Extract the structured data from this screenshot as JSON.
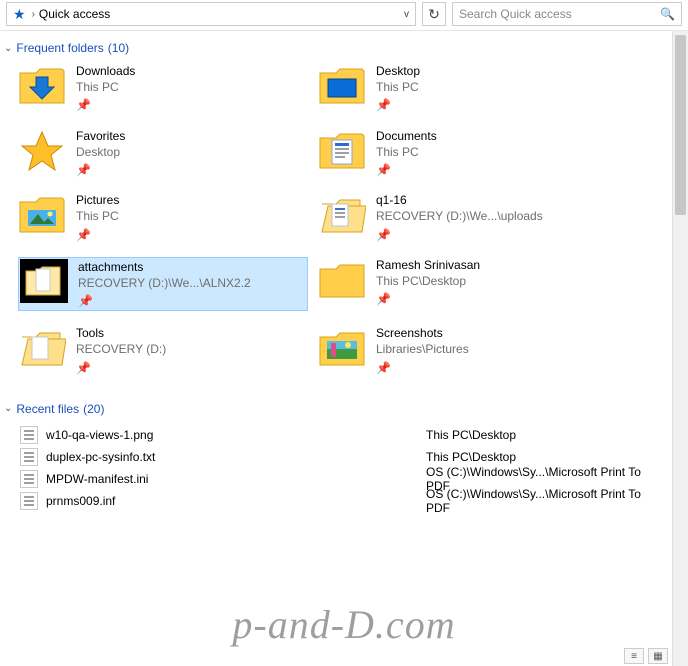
{
  "addressbar": {
    "location": "Quick access"
  },
  "search": {
    "placeholder": "Search Quick access"
  },
  "groups": {
    "frequent": {
      "label": "Frequent folders",
      "count": "(10)"
    },
    "recent": {
      "label": "Recent files",
      "count": "(20)"
    }
  },
  "folders": {
    "col1": [
      {
        "name": "Downloads",
        "path": "This PC",
        "icon": "downloads"
      },
      {
        "name": "Favorites",
        "path": "Desktop",
        "icon": "favorites"
      },
      {
        "name": "Pictures",
        "path": "This PC",
        "icon": "pictures"
      },
      {
        "name": "attachments",
        "path": "RECOVERY (D:)\\We...\\ALNX2.2",
        "icon": "folder",
        "selected": true
      },
      {
        "name": "Tools",
        "path": "RECOVERY (D:)",
        "icon": "folder"
      }
    ],
    "col2": [
      {
        "name": "Desktop",
        "path": "This PC",
        "icon": "desktop"
      },
      {
        "name": "Documents",
        "path": "This PC",
        "icon": "documents"
      },
      {
        "name": "q1-16",
        "path": "RECOVERY (D:)\\We...\\uploads",
        "icon": "folder-open"
      },
      {
        "name": "Ramesh Srinivasan",
        "path": "This PC\\Desktop",
        "icon": "folder"
      },
      {
        "name": "Screenshots",
        "path": "Libraries\\Pictures",
        "icon": "screenshots"
      }
    ]
  },
  "recent_files": [
    {
      "name": "w10-qa-views-1.png",
      "path": "This PC\\Desktop"
    },
    {
      "name": "duplex-pc-sysinfo.txt",
      "path": "This PC\\Desktop"
    },
    {
      "name": "MPDW-manifest.ini",
      "path": "OS (C:)\\Windows\\Sy...\\Microsoft Print To PDF"
    },
    {
      "name": "prnms009.inf",
      "path": "OS (C:)\\Windows\\Sy...\\Microsoft Print To PDF"
    }
  ],
  "watermark": "p-and-D.com"
}
